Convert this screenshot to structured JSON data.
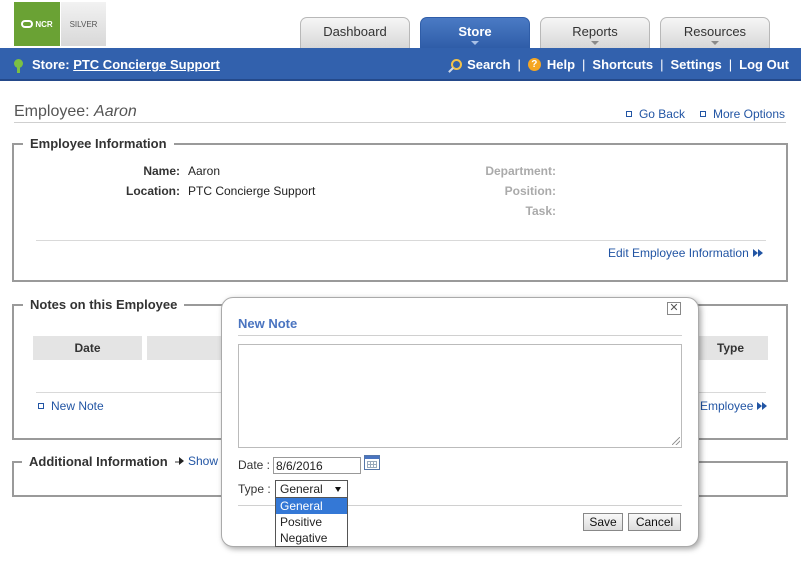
{
  "header": {
    "logo_ncr": "NCR",
    "logo_silver": "SILVER",
    "tabs": [
      {
        "label": "Dashboard",
        "active": false
      },
      {
        "label": "Store",
        "active": true
      },
      {
        "label": "Reports",
        "active": false
      },
      {
        "label": "Resources",
        "active": false
      }
    ]
  },
  "navbar": {
    "store_prefix": "Store:",
    "store_name": "PTC Concierge Support",
    "links": [
      "Search",
      "Help",
      "Shortcuts",
      "Settings",
      "Log Out"
    ],
    "separator": "|"
  },
  "page": {
    "title_prefix": "Employee:",
    "employee_name": "Aaron",
    "go_back": "Go Back",
    "more_options": "More Options"
  },
  "employee_info": {
    "legend": "Employee Information",
    "name_label": "Name:",
    "name_value": "Aaron",
    "location_label": "Location:",
    "location_value": "PTC Concierge Support",
    "department_label": "Department:",
    "position_label": "Position:",
    "task_label": "Task:",
    "edit_link": "Edit Employee Information"
  },
  "notes": {
    "legend": "Notes on this Employee",
    "columns": [
      "Date",
      "Type"
    ],
    "new_note_link": "New Note",
    "right_link_visible": "Employee"
  },
  "additional": {
    "legend": "Additional Information",
    "show_link": "Show"
  },
  "modal": {
    "title": "New Note",
    "close_symbol": "✕",
    "date_label": "Date :",
    "date_value": "8/6/2016",
    "type_label": "Type :",
    "type_selected": "General",
    "type_options": [
      "General",
      "Positive",
      "Negative"
    ],
    "save_label": "Save",
    "cancel_label": "Cancel"
  },
  "colors": {
    "nav_blue": "#3261ad",
    "link_blue": "#2255a4",
    "modal_title": "#4a74c0",
    "ncr_green": "#6aa234"
  }
}
